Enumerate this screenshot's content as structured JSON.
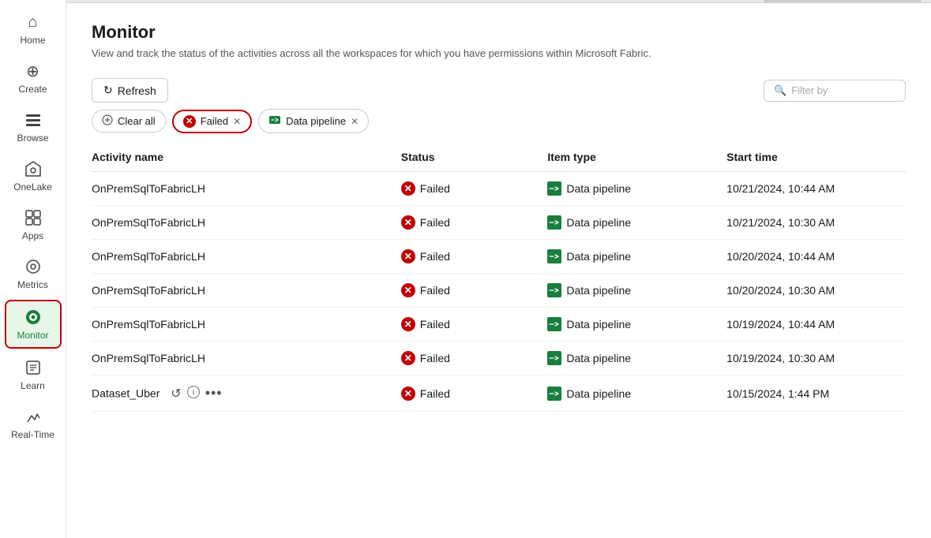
{
  "sidebar": {
    "items": [
      {
        "id": "home",
        "label": "Home",
        "icon": "⌂",
        "active": false
      },
      {
        "id": "create",
        "label": "Create",
        "icon": "⊕",
        "active": false
      },
      {
        "id": "browse",
        "label": "Browse",
        "icon": "☰",
        "active": false
      },
      {
        "id": "onelake",
        "label": "OneLake",
        "icon": "◈",
        "active": false
      },
      {
        "id": "apps",
        "label": "Apps",
        "icon": "⧉",
        "active": false
      },
      {
        "id": "metrics",
        "label": "Metrics",
        "icon": "⊚",
        "active": false
      },
      {
        "id": "monitor",
        "label": "Monitor",
        "icon": "●",
        "active": true
      },
      {
        "id": "learn",
        "label": "Learn",
        "icon": "□",
        "active": false
      },
      {
        "id": "realtime",
        "label": "Real-Time",
        "icon": "⚡",
        "active": false
      }
    ]
  },
  "page": {
    "title": "Monitor",
    "subtitle": "View and track the status of the activities across all the workspaces for which you have permissions within Microsoft Fabric."
  },
  "toolbar": {
    "refresh_label": "Refresh",
    "filter_placeholder": "Filter by"
  },
  "filters": {
    "clear_all_label": "Clear all",
    "tags": [
      {
        "id": "failed",
        "label": "Failed",
        "type": "failed"
      },
      {
        "id": "data-pipeline",
        "label": "Data pipeline",
        "type": "pipeline"
      }
    ]
  },
  "table": {
    "columns": [
      "Activity name",
      "Status",
      "Item type",
      "Start time"
    ],
    "rows": [
      {
        "name": "OnPremSqlToFabricLH",
        "status": "Failed",
        "item_type": "Data pipeline",
        "start_time": "10/21/2024, 10:44 AM",
        "show_actions": false
      },
      {
        "name": "OnPremSqlToFabricLH",
        "status": "Failed",
        "item_type": "Data pipeline",
        "start_time": "10/21/2024, 10:30 AM",
        "show_actions": false
      },
      {
        "name": "OnPremSqlToFabricLH",
        "status": "Failed",
        "item_type": "Data pipeline",
        "start_time": "10/20/2024, 10:44 AM",
        "show_actions": false
      },
      {
        "name": "OnPremSqlToFabricLH",
        "status": "Failed",
        "item_type": "Data pipeline",
        "start_time": "10/20/2024, 10:30 AM",
        "show_actions": false
      },
      {
        "name": "OnPremSqlToFabricLH",
        "status": "Failed",
        "item_type": "Data pipeline",
        "start_time": "10/19/2024, 10:44 AM",
        "show_actions": false
      },
      {
        "name": "OnPremSqlToFabricLH",
        "status": "Failed",
        "item_type": "Data pipeline",
        "start_time": "10/19/2024, 10:30 AM",
        "show_actions": false
      },
      {
        "name": "Dataset_Uber",
        "status": "Failed",
        "item_type": "Data pipeline",
        "start_time": "10/15/2024, 1:44 PM",
        "show_actions": true
      }
    ]
  },
  "colors": {
    "failed_red": "#c00000",
    "pipeline_green": "#1a7f3c",
    "monitor_active": "#1a7f3c",
    "border_highlight": "#c00000"
  }
}
